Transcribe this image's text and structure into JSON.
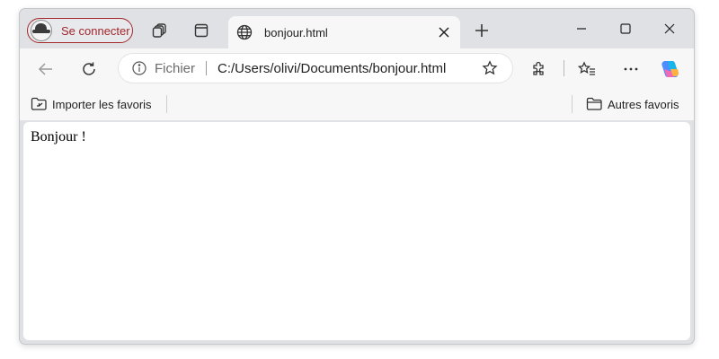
{
  "profile": {
    "label": "Se connecter"
  },
  "tab": {
    "title": "bonjour.html",
    "icon": "globe-icon"
  },
  "addressbar": {
    "scheme_label": "Fichier",
    "url": "C:/Users/olivi/Documents/bonjour.html"
  },
  "favorites": {
    "import_label": "Importer les favoris",
    "other_label": "Autres favoris"
  },
  "page": {
    "text": "Bonjour !"
  },
  "colors": {
    "profile_accent": "#a3272b",
    "frame": "#dfe1e5",
    "toolbar": "#f7f7f7"
  }
}
